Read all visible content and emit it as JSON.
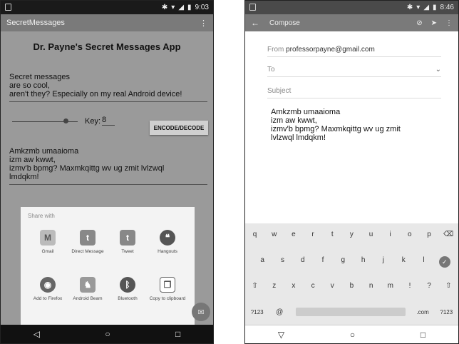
{
  "left": {
    "status": {
      "wifi": "▾",
      "signal": "◢",
      "battery": "▮",
      "time": "9:03",
      "bt": "✱"
    },
    "app_bar": {
      "title": "SecretMessages",
      "menu": "⋮"
    },
    "main": {
      "title": "Dr. Payne's Secret Messages App",
      "input_lines": [
        "Secret messages",
        "are so cool,",
        "aren't they? Especially on my real Android device!"
      ],
      "key_label": "Key:",
      "key_value": "8",
      "encode_button": "ENCODE/DECODE",
      "output_lines": [
        "Amkzmb umaaioma",
        "izm aw kwwt,",
        "izmv'b bpmg? Maxmkqittg wv ug zmit lvlzwql",
        "lmdqkm!"
      ]
    },
    "share": {
      "title": "Share with",
      "items": [
        {
          "label": "Gmail",
          "icon": "gmail-icon",
          "glyph": "M"
        },
        {
          "label": "Direct Message",
          "icon": "twitter-icon",
          "glyph": "t"
        },
        {
          "label": "Tweet",
          "icon": "twitter-icon",
          "glyph": "t"
        },
        {
          "label": "Hangouts",
          "icon": "hangouts-icon",
          "glyph": "❝"
        },
        {
          "label": "Add to Firefox",
          "icon": "firefox-icon",
          "glyph": "◉"
        },
        {
          "label": "Android Beam",
          "icon": "android-beam-icon",
          "glyph": "♞"
        },
        {
          "label": "Bluetooth",
          "icon": "bluetooth-icon",
          "glyph": "ᛒ"
        },
        {
          "label": "Copy to clipboard",
          "icon": "clipboard-icon",
          "glyph": "❐"
        }
      ]
    },
    "fab_glyph": "✉",
    "nav": {
      "back": "◁",
      "home": "○",
      "recents": "□"
    }
  },
  "right": {
    "status": {
      "time": "8:46",
      "bt": "✱",
      "wifi": "▾",
      "signal": "◢",
      "battery": "▮"
    },
    "app_bar": {
      "back": "←",
      "title": "Compose",
      "attach": "⊘",
      "send": "➤",
      "menu": "⋮"
    },
    "from_label": "From",
    "from_value": "professorpayne@gmail.com",
    "to_label": "To",
    "subject_placeholder": "Subject",
    "body_lines": [
      "Amkzmb umaaioma",
      "izm aw kwwt,",
      "izmv'b bpmg? Maxmkqittg wv ug zmit",
      "lvlzwql lmdqkm!"
    ],
    "keyboard": {
      "row1": [
        "q",
        "w",
        "e",
        "r",
        "t",
        "y",
        "u",
        "i",
        "o",
        "p",
        "⌫"
      ],
      "row2": [
        "a",
        "s",
        "d",
        "f",
        "g",
        "h",
        "j",
        "k",
        "l",
        "✓"
      ],
      "row3": [
        "⇧",
        "z",
        "x",
        "c",
        "v",
        "b",
        "n",
        "m",
        "!",
        "?",
        "⇧"
      ],
      "row4_left": "?123",
      "row4_at": "@",
      "row4_com": ".com",
      "row4_right": "?123"
    },
    "nav": {
      "back": "▽",
      "home": "○",
      "recents": "□"
    }
  }
}
